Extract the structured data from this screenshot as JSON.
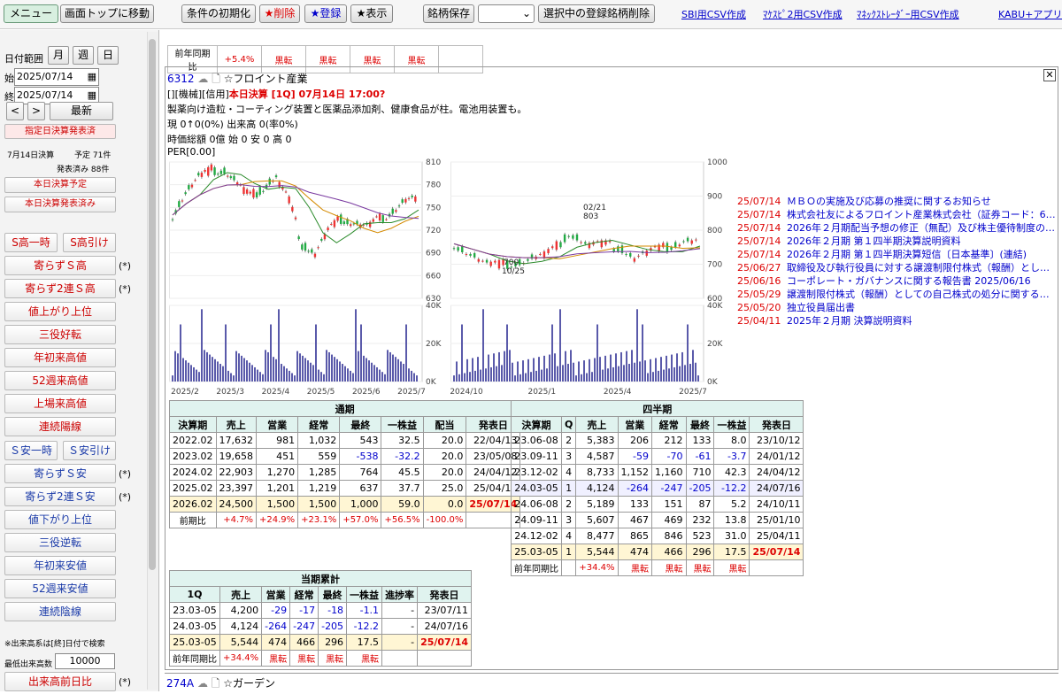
{
  "topbar": {
    "menu": "メニュー",
    "top": "画面トップに移動",
    "reset": "条件の初期化",
    "delete": "★削除",
    "register": "★登録",
    "show": "★表示",
    "save": "銘柄保存",
    "select_value": "",
    "delete_selected": "選択中の登録銘柄削除",
    "csv_sbi": "SBI用CSV作成",
    "csv_kabu": "ﾏｹｽﾋﾟ2用CSV作成",
    "csv_monex": "ﾏﾈｯｸｽﾄﾚｰﾀﾞｰ用CSV作成",
    "csv_kabuplus": "KABU+アプリ"
  },
  "sidebar": {
    "range_label": "日付範囲",
    "month": "月",
    "week": "週",
    "day": "日",
    "start_label": "始",
    "end_label": "終",
    "start_date": "2025/07/14",
    "end_date": "2025/07/14",
    "prev": "<",
    "next": ">",
    "latest": "最新",
    "specified": "指定日決算発表済",
    "stats": {
      "date": "7月14日決算",
      "plan": "予定 71件",
      "done": "発表済み 88件"
    },
    "today_plan": "本日決算予定",
    "today_done": "本日決算発表済み",
    "buttons": [
      {
        "label": "S高一時"
      },
      {
        "label": "S高引け"
      }
    ],
    "list1": [
      "寄らずＳ高",
      "寄らず2連Ｓ高",
      "値上がり上位",
      "三役好転",
      "年初来高値",
      "52週来高値",
      "上場来高値",
      "連続陽線"
    ],
    "stars1": [
      "(*)",
      "(*)"
    ],
    "sbuttons": [
      {
        "label": "Ｓ安一時"
      },
      {
        "label": "Ｓ安引け"
      }
    ],
    "list2": [
      "寄らずＳ安",
      "寄らず2連Ｓ安",
      "値下がり上位",
      "三役逆転",
      "年初来安値",
      "52週来安値",
      "連続陰線"
    ],
    "stars2": [
      "(*)",
      "(*)"
    ],
    "note": "※出来高系は[終]日付で検索",
    "min_vol_label": "最低出来高数",
    "min_vol": "10000",
    "vol_ratio": "出来高前日比",
    "vol_star": "(*)"
  },
  "prev_row": {
    "label": "前年同期比",
    "cells": [
      "+5.4%",
      "黒転",
      "黒転",
      "黒転",
      "黒転"
    ]
  },
  "stock": {
    "code": "6312",
    "name": "☆フロイント産業",
    "tags": "[][機械][信用]",
    "tag_decision": "本日決算 [1Q] 07月14日 17:00?",
    "desc": "製薬向け造粒・コーティング装置と医薬品添加剤、健康食品が柱。電池用装置も。",
    "price": "現 0↑0(0%) 出来高 0(率0%)",
    "mcap": "時価総額 0億 始 0 安 0 高 0",
    "per": "PER[0.00]"
  },
  "chart_data": [
    {
      "type": "line",
      "ylabel": "",
      "ylim": [
        630,
        810
      ],
      "yticks": [
        810,
        780,
        750,
        720,
        690,
        660,
        630
      ],
      "xticks": [
        "2025/2",
        "2025/3",
        "2025/4",
        "2025/5",
        "2025/6",
        "2025/7"
      ],
      "x": [
        0,
        6,
        12,
        18,
        24,
        30,
        36,
        42,
        48,
        54,
        60,
        66,
        72,
        78,
        84,
        90,
        96,
        100
      ],
      "series": [
        {
          "values": [
            740,
            770,
            790,
            800,
            798,
            782,
            765,
            775,
            790,
            760,
            700,
            690,
            720,
            735,
            730,
            725,
            735,
            745,
            760
          ]
        }
      ]
    },
    {
      "type": "bar",
      "ylim": [
        0,
        40000
      ],
      "yticks": [
        "40K",
        "20K",
        "0K"
      ],
      "xticks": [
        "2025/2",
        "2025/3",
        "2025/4",
        "2025/5",
        "2025/6",
        "2025/7"
      ]
    },
    {
      "type": "line",
      "ylim": [
        600,
        1000
      ],
      "yticks": [
        1000,
        900,
        800,
        700,
        600
      ],
      "xticks": [
        "2024/10",
        "2025/1",
        "2025/4",
        "2025/7"
      ],
      "annotations": [
        "02/21",
        "803",
        "700",
        "10/25"
      ],
      "series": [
        {
          "values": [
            760,
            730,
            700,
            700,
            705,
            720,
            740,
            790,
            760,
            760,
            750,
            720,
            740,
            750,
            770
          ]
        }
      ]
    },
    {
      "type": "bar",
      "ylim": [
        0,
        40000
      ],
      "yticks": [
        "40K",
        "20K",
        "0K"
      ],
      "xticks": [
        "2024/10",
        "2025/1",
        "2025/4",
        "2025/7"
      ]
    }
  ],
  "annual": {
    "title": "通期",
    "headers": [
      "決算期",
      "売上",
      "営業",
      "経常",
      "最終",
      "一株益",
      "配当",
      "発表日"
    ],
    "rows": [
      [
        "2022.02",
        "17,632",
        "981",
        "1,032",
        "543",
        "32.5",
        "20.0",
        "22/04/13"
      ],
      [
        "2023.02",
        "19,658",
        "451",
        "559",
        "-538",
        "-32.2",
        "20.0",
        "23/05/08"
      ],
      [
        "2024.02",
        "22,903",
        "1,270",
        "1,285",
        "764",
        "45.5",
        "20.0",
        "24/04/12"
      ],
      [
        "2025.02",
        "23,397",
        "1,201",
        "1,219",
        "637",
        "37.7",
        "25.0",
        "25/04/11"
      ],
      [
        "2026.02",
        "24,500",
        "1,500",
        "1,500",
        "1,000",
        "59.0",
        "0.0",
        "25/07/14"
      ]
    ],
    "ratio": [
      "前期比",
      "+4.7%",
      "+24.9%",
      "+23.1%",
      "+57.0%",
      "+56.5%",
      "-100.0%",
      ""
    ]
  },
  "quarterly": {
    "title": "四半期",
    "headers": [
      "決算期",
      "Q",
      "売上",
      "営業",
      "経常",
      "最終",
      "一株益",
      "発表日"
    ],
    "rows": [
      [
        "23.06-08",
        "2",
        "5,383",
        "206",
        "212",
        "133",
        "8.0",
        "23/10/12"
      ],
      [
        "23.09-11",
        "3",
        "4,587",
        "-59",
        "-70",
        "-61",
        "-3.7",
        "24/01/12"
      ],
      [
        "23.12-02",
        "4",
        "8,733",
        "1,152",
        "1,160",
        "710",
        "42.3",
        "24/04/12"
      ],
      [
        "24.03-05",
        "1",
        "4,124",
        "-264",
        "-247",
        "-205",
        "-12.2",
        "24/07/16"
      ],
      [
        "24.06-08",
        "2",
        "5,189",
        "133",
        "151",
        "87",
        "5.2",
        "24/10/11"
      ],
      [
        "24.09-11",
        "3",
        "5,607",
        "467",
        "469",
        "232",
        "13.8",
        "25/01/10"
      ],
      [
        "24.12-02",
        "4",
        "8,477",
        "865",
        "846",
        "523",
        "31.0",
        "25/04/11"
      ],
      [
        "25.03-05",
        "1",
        "5,544",
        "474",
        "466",
        "296",
        "17.5",
        "25/07/14"
      ]
    ],
    "ratio": [
      "前年同期比",
      "",
      "+34.4%",
      "黒転",
      "黒転",
      "黒転",
      "黒転",
      ""
    ]
  },
  "cumulative": {
    "title": "当期累計",
    "headers": [
      "1Q",
      "売上",
      "営業",
      "経常",
      "最終",
      "一株益",
      "進捗率",
      "発表日"
    ],
    "rows": [
      [
        "23.03-05",
        "4,200",
        "-29",
        "-17",
        "-18",
        "-1.1",
        "-",
        "23/07/11"
      ],
      [
        "24.03-05",
        "4,124",
        "-264",
        "-247",
        "-205",
        "-12.2",
        "-",
        "24/07/16"
      ],
      [
        "25.03-05",
        "5,544",
        "474",
        "466",
        "296",
        "17.5",
        "-",
        "25/07/14"
      ]
    ],
    "ratio": [
      "前年同期比",
      "+34.4%",
      "黒転",
      "黒転",
      "黒転",
      "黒転",
      "",
      ""
    ]
  },
  "news": [
    [
      "25/07/14",
      "ＭＢＯの実施及び応募の推奨に関するお知らせ"
    ],
    [
      "25/07/14",
      "株式会社友によるフロイント産業株式会社（証券コード：6…"
    ],
    [
      "25/07/14",
      "2026年２月期配当予想の修正（無配）及び株主優待制度の…"
    ],
    [
      "25/07/14",
      "2026年２月期 第１四半期決算説明資料"
    ],
    [
      "25/07/14",
      "2026年２月期 第１四半期決算短信〔日本基準〕(連結)"
    ],
    [
      "25/06/27",
      "取締役及び執行役員に対する譲渡制限付株式（報酬）とし…"
    ],
    [
      "25/06/16",
      "コーポレート・ガバナンスに関する報告書 2025/06/16"
    ],
    [
      "25/05/29",
      "譲渡制限付株式（報酬）としての自己株式の処分に関する…"
    ],
    [
      "25/05/20",
      "独立役員届出書"
    ],
    [
      "25/04/11",
      "2025年２月期 決算説明資料"
    ]
  ],
  "next_stock": {
    "code": "274A",
    "name": "☆ガーデン"
  }
}
